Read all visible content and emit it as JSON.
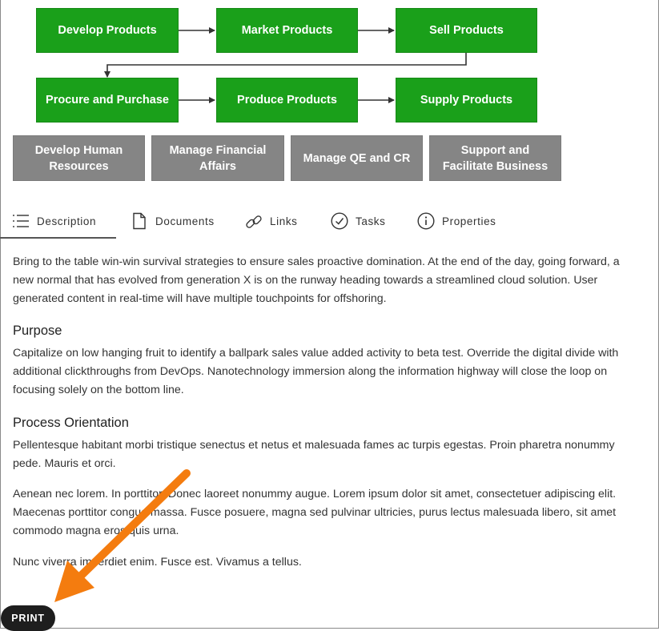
{
  "process_map": {
    "row1": [
      {
        "label": "Develop Products"
      },
      {
        "label": "Market Products"
      },
      {
        "label": "Sell Products"
      }
    ],
    "row2": [
      {
        "label": "Procure and Purchase"
      },
      {
        "label": "Produce Products"
      },
      {
        "label": "Supply Products"
      }
    ],
    "support": [
      {
        "label": "Develop Human Resources"
      },
      {
        "label": "Manage Financial Affairs"
      },
      {
        "label": "Manage QE and CR"
      },
      {
        "label": "Support and Facilitate Business"
      }
    ],
    "colors": {
      "core": "#1aa01a",
      "support": "#858585",
      "connector": "#333333"
    }
  },
  "tabs": [
    {
      "label": "Description",
      "icon": "list-icon",
      "active": true
    },
    {
      "label": "Documents",
      "icon": "document-icon"
    },
    {
      "label": "Links",
      "icon": "link-icon"
    },
    {
      "label": "Tasks",
      "icon": "check-circle-icon"
    },
    {
      "label": "Properties",
      "icon": "info-icon"
    }
  ],
  "content": {
    "intro": "Bring to the table win-win survival strategies to ensure sales proactive domination. At the end of the day, going forward, a new normal that has evolved from generation X is on the runway heading towards a streamlined cloud solution. User generated content in real-time will have multiple touchpoints for offshoring.",
    "purpose_heading": "Purpose",
    "purpose_text": "Capitalize on low hanging fruit to identify a ballpark sales value added activity to beta test. Override the digital divide with additional clickthroughs from DevOps. Nanotechnology immersion along the information highway will close the loop on focusing solely on the bottom line.",
    "orientation_heading": "Process Orientation",
    "orientation_p1": "Pellentesque habitant morbi tristique senectus et netus et malesuada fames ac turpis egestas. Proin pharetra nonummy pede. Mauris et orci.",
    "orientation_p2": "Aenean nec lorem. In porttitor. Donec laoreet nonummy augue. Lorem ipsum dolor sit amet, consectetuer adipiscing elit. Maecenas porttitor congue massa. Fusce posuere, magna sed pulvinar ultricies, purus lectus malesuada libero, sit amet commodo magna eros quis urna.",
    "orientation_p3": "Nunc viverra imperdiet enim. Fusce est. Vivamus a tellus."
  },
  "print_button": {
    "label": "PRINT"
  },
  "annotation": {
    "arrow_color": "#f47c0f"
  }
}
